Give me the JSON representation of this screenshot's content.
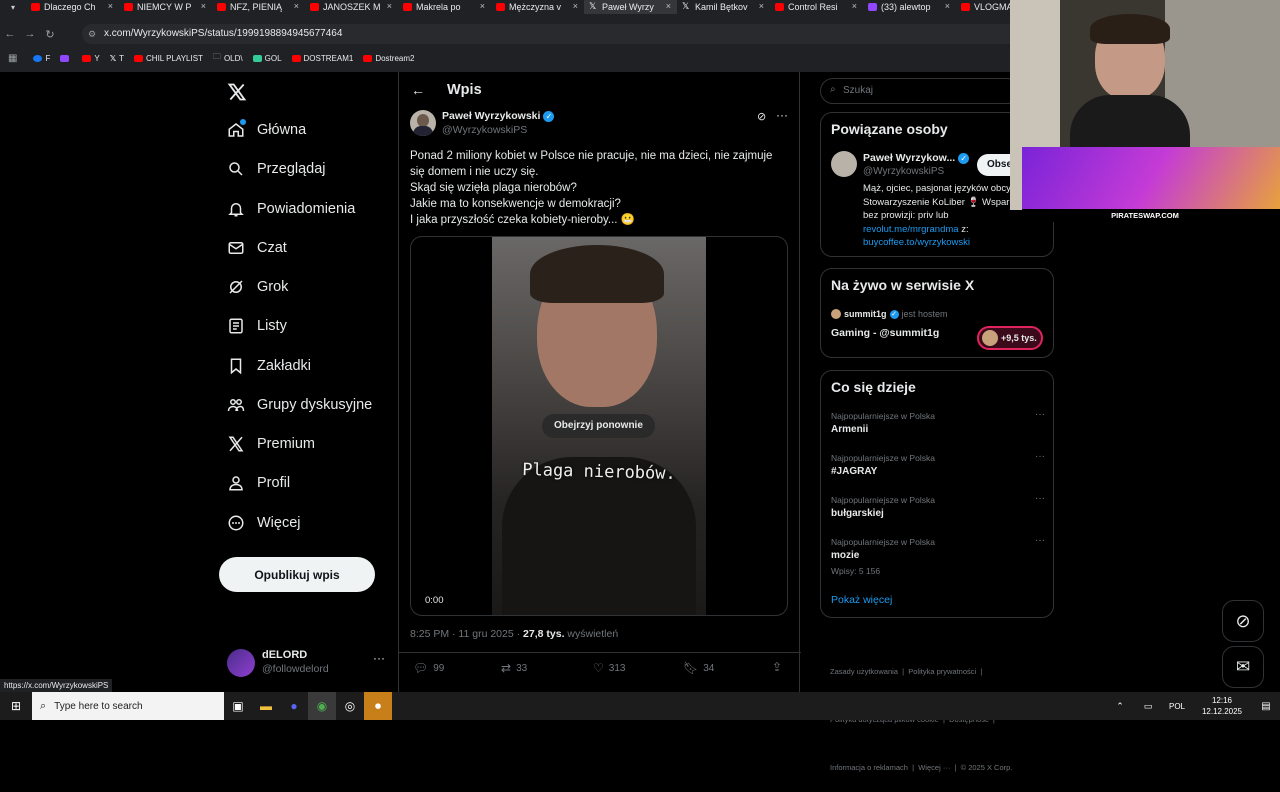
{
  "browser": {
    "tabs": [
      {
        "title": "Dlaczego Ch",
        "icon": "youtube-icon"
      },
      {
        "title": "NIEMCY W P",
        "icon": "youtube-icon"
      },
      {
        "title": "NFZ, PIENIĄ",
        "icon": "youtube-icon"
      },
      {
        "title": "JANOSZEK M",
        "icon": "youtube-icon"
      },
      {
        "title": "Makrela po",
        "icon": "youtube-icon"
      },
      {
        "title": "Mężczyzna v",
        "icon": "youtube-icon"
      },
      {
        "title": "Paweł Wyrzy",
        "icon": "x-icon"
      },
      {
        "title": "Kamil Bętkov",
        "icon": "x-icon"
      },
      {
        "title": "Control Resi",
        "icon": "youtube-icon"
      },
      {
        "title": "(33) alewtop",
        "icon": "twitch-icon"
      },
      {
        "title": "VLOGMAS",
        "icon": "youtube-icon"
      }
    ],
    "url": "x.com/WyrzykowskiPS/status/1999198894945677464",
    "bookmarks": [
      {
        "label": "F"
      },
      {
        "label": ""
      },
      {
        "label": "Y"
      },
      {
        "label": "T"
      },
      {
        "label": "CHIL PLAYLIST"
      },
      {
        "label": "OLD\\"
      },
      {
        "label": "GOL"
      },
      {
        "label": "DOSTREAM1"
      },
      {
        "label": "Dostream2"
      }
    ],
    "status_url": "https://x.com/WyrzykowskiPS"
  },
  "nav": {
    "items": [
      {
        "label": "Główna",
        "icon": "home-icon"
      },
      {
        "label": "Przeglądaj",
        "icon": "search-icon"
      },
      {
        "label": "Powiadomienia",
        "icon": "bell-icon"
      },
      {
        "label": "Czat",
        "icon": "mail-icon"
      },
      {
        "label": "Grok",
        "icon": "grok-icon"
      },
      {
        "label": "Listy",
        "icon": "list-icon"
      },
      {
        "label": "Zakładki",
        "icon": "bookmark-icon"
      },
      {
        "label": "Grupy dyskusyjne",
        "icon": "communities-icon"
      },
      {
        "label": "Premium",
        "icon": "x-icon"
      },
      {
        "label": "Profil",
        "icon": "person-icon"
      },
      {
        "label": "Więcej",
        "icon": "more-circle-icon"
      }
    ],
    "post_button": "Opublikuj wpis",
    "account": {
      "name": "dELORD",
      "handle": "@followdelord"
    }
  },
  "post": {
    "header": "Wpis",
    "author_name": "Paweł Wyrzykowski",
    "author_handle": "@WyrzykowskiPS",
    "text_lines": [
      "Ponad 2 miliony kobiet w Polsce nie pracuje, nie ma dzieci, nie zajmuje",
      "się domem i nie uczy się.",
      "Skąd się wzięła plaga nierobów?",
      "Jakie ma to konsekwencje w demokracji?",
      "I jaka przyszłość czeka kobiety-nieroby... 😬"
    ],
    "video": {
      "replay_label": "Obejrzyj ponownie",
      "caption": "Plaga nierobów.",
      "time": "0:00"
    },
    "meta_time": "8:25 PM · 11 gru 2025 · ",
    "views_count": "27,8 tys.",
    "views_label": " wyświetleń",
    "actions": {
      "replies": "99",
      "reposts": "33",
      "likes": "313",
      "bookmarks": "34"
    }
  },
  "sidebar": {
    "search_placeholder": "Szukaj",
    "related": {
      "title": "Powiązane osoby",
      "name": "Paweł Wyrzykow...",
      "handle": "@WyrzykowskiPS",
      "follow": "Obserwuj",
      "bio_lines": [
        "Mąż, ojciec, pasjonat języków obcy",
        "Stowarzyszenie KoLiber 🍷 Wsparc",
        "bez prowizji: priv lub"
      ],
      "link1": "revolut.me/mrgrandma",
      "link1_suffix": " z:",
      "link2": "buycoffee.to/wyrzykowski"
    },
    "live": {
      "title": "Na żywo w serwisie X",
      "host_name": "summit1g",
      "host_label": " jest hostem",
      "space_title": "Gaming - @summit1g",
      "listeners": "+9,5 tys."
    },
    "trends": {
      "title": "Co się dzieje",
      "items": [
        {
          "context": "Najpopularniejsze w Polska",
          "name": "Armenii",
          "posts": ""
        },
        {
          "context": "Najpopularniejsze w Polska",
          "name": "#JAGRAY",
          "posts": ""
        },
        {
          "context": "Najpopularniejsze w Polska",
          "name": "bułgarskiej",
          "posts": ""
        },
        {
          "context": "Najpopularniejsze w Polska",
          "name": "mozie",
          "posts": "Wpisy: 5 156"
        }
      ],
      "show_more": "Pokaż więcej"
    },
    "footer_lines": [
      "Zasady użytkowania  |  Polityka prywatności  |",
      "Polityka dotycząca plików cookie  |  Dostępność  |",
      "Informacja o reklamach  |  Więcej ···  |  © 2025 X Corp."
    ]
  },
  "overlay": {
    "ad_text": "PIRATESWAP.COM"
  },
  "taskbar": {
    "search_placeholder": "Type here to search",
    "lang": "POL",
    "time": "12:16",
    "date": "12.12.2025"
  },
  "colors": {
    "accent": "#1d9bf0",
    "background": "#000000",
    "border": "#2f3336",
    "muted": "#71767b"
  }
}
